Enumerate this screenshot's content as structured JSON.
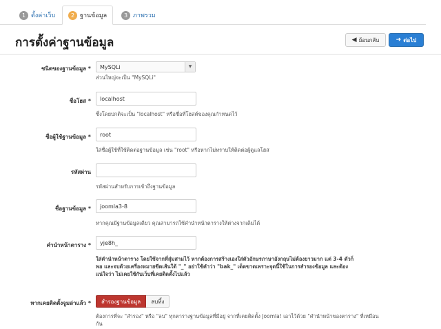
{
  "tabs": [
    {
      "num": "1",
      "label": "ตั้งค่าเว็บ"
    },
    {
      "num": "2",
      "label": "ฐานข้อมูล"
    },
    {
      "num": "3",
      "label": "ภาพรวม"
    }
  ],
  "header": {
    "title": "การตั้งค่าฐานข้อมูล",
    "prev_label": "ย้อนกลับ",
    "next_label": "ต่อไป"
  },
  "form": {
    "db_type": {
      "label": "ชนิดของฐานข้อมูล *",
      "value": "MySQLi",
      "help": "ส่วนใหญ่จะเป็น \"MySQLi\""
    },
    "host": {
      "label": "ชื่อโฮส *",
      "value": "localhost",
      "help": "ซึ่งโดยปกติจะเป็น \"localhost\" หรือชื่อที่โฮสต์ของคุณกำหนดไว้"
    },
    "username": {
      "label": "ชื่อผู้ใช้ฐานข้อมูล *",
      "value": "root",
      "help": "ใส่ชื่อผู้ใช้ที่ใช้ติดต่อฐานข้อมูล เช่น \"root\" หรือหากไม่ทราบให้ติดต่อผู้ดูแลโฮส"
    },
    "password": {
      "label": "รหัสผ่าน",
      "value": "",
      "help": "รหัสผ่านสำหรับการเข้าถึงฐานข้อมูล"
    },
    "db_name": {
      "label": "ชื่อฐานข้อมูล *",
      "value": "joomla3-8",
      "help": "หากคุณมีฐานข้อมูลเดียว คุณสามารถใช้คำนำหน้าตารางให้ต่างจากเดิมได้"
    },
    "prefix": {
      "label": "คำนำหน้าตาราง *",
      "value": "yje8h_",
      "help_1": "ใส่คำนำหน้าตาราง โดยใช้จากที่สุ่มสามไว้ หากต้องการสร้างเองใส่ตัวอักษรภาษาอังกฤษไม่ต้องยาวมาก แต่ 3-4 ตัวก็",
      "help_2": "พอ และจบด้วยเครื่องหมายขีดเส้นใต้ \"_\" อย่าใช้คำว่า \"bak_\" เด็ดขาดเพราะจุดนี้ใช้ในการสำรองข้อมูล และต้อง",
      "help_3": "แน่ใจว่า ไม่เคยใช้กับเว็บที่เคยติดตั้งไปแล้ว"
    },
    "old_db": {
      "label": "หากเคยติดตั้งจูมล่าแล้ว *",
      "backup_label": "สำรองฐานข้อมูล",
      "delete_label": "ลบทิ้ง",
      "help_1": "ต้องการที่จะ \"สำรอง\" หรือ \"ลบ\" ทุกตารางฐานข้อมูลที่มีอยู่ จากที่เคยติดตั้ง Joomla! เอาไว้ด้วย \"คำนำหน้าของตาราง\" ที่เหมือน",
      "help_2": "กัน"
    }
  },
  "colors": {
    "accent": "#2a7fd4",
    "danger": "#bd362f",
    "step_active": "#f0ad4e"
  }
}
